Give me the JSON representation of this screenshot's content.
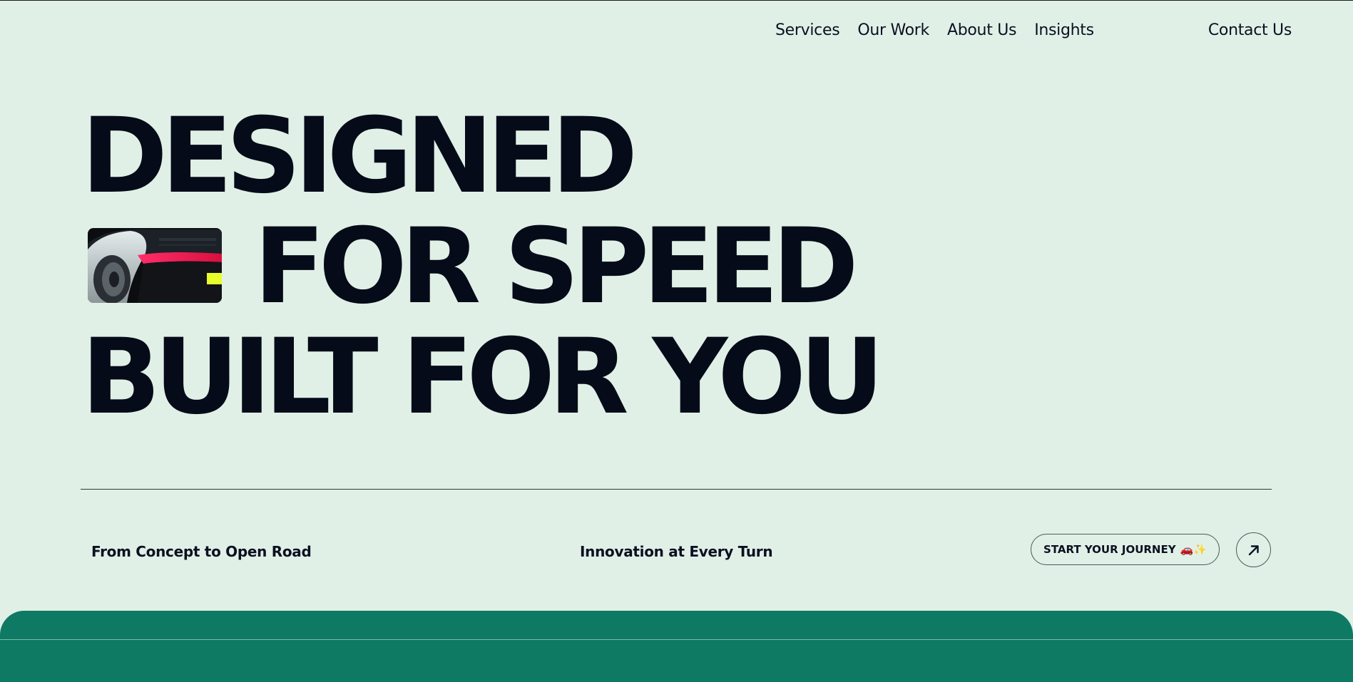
{
  "nav": {
    "items": [
      {
        "label": "Services"
      },
      {
        "label": "Our Work"
      },
      {
        "label": "About Us"
      },
      {
        "label": "Insights"
      }
    ],
    "contact_label": "Contact Us"
  },
  "hero": {
    "line1": "DESIGNED",
    "line2": "FOR SPEED",
    "line3": "BUILT FOR YOU",
    "thumbnail": "car-taillight-image"
  },
  "footer_row": {
    "tagline_left": "From Concept to Open Road",
    "tagline_center": "Innovation at Every Turn",
    "cta_label": "START YOUR JOURNEY",
    "cta_emoji": "🚗✨",
    "arrow_icon": "arrow-up-right-icon"
  },
  "colors": {
    "background": "#e1f0e7",
    "text": "#050b18",
    "band": "#0f7a63"
  }
}
